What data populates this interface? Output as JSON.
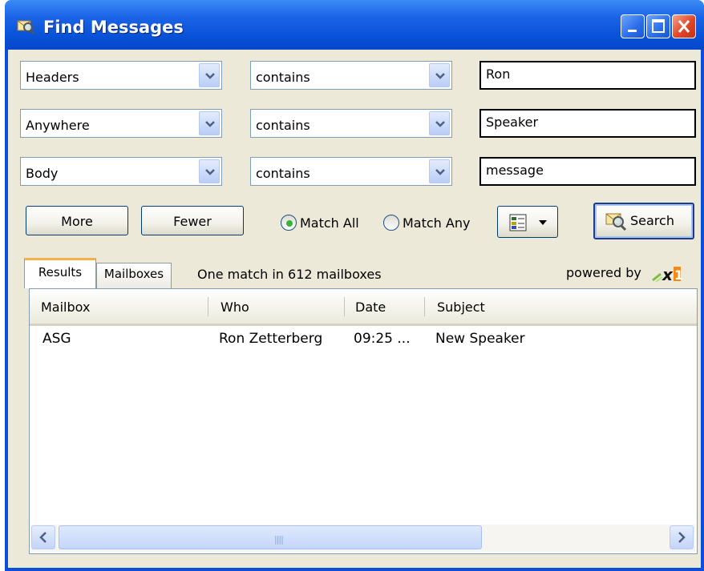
{
  "window": {
    "title": "Find Messages"
  },
  "criteria": [
    {
      "field": "Headers",
      "operator": "contains",
      "value": "Ron"
    },
    {
      "field": "Anywhere",
      "operator": "contains",
      "value": "Speaker"
    },
    {
      "field": "Body",
      "operator": "contains",
      "value": "message"
    }
  ],
  "buttons": {
    "more": "More",
    "fewer": "Fewer",
    "search": "Search"
  },
  "match": {
    "all_label": "Match All",
    "any_label": "Match Any",
    "selected": "all"
  },
  "tabs": {
    "results": "Results",
    "mailboxes": "Mailboxes",
    "active": "results"
  },
  "status_text": "One match in 612 mailboxes",
  "powered_by": "powered by",
  "table": {
    "columns": [
      "Mailbox",
      "Who",
      "Date",
      "Subject"
    ],
    "rows": [
      {
        "mailbox": "ASG",
        "who": "Ron Zetterberg",
        "date": "09:25 ...",
        "subject": "New Speaker"
      }
    ]
  },
  "colors": {
    "title_bar": "#0a4fd8",
    "client_bg": "#ece9d8",
    "radio_dot": "#3ab33a",
    "tab_highlight": "#f4b04a"
  },
  "icons": {
    "title": "find-messages-icon",
    "view": "column-view-icon",
    "search": "search-magnifier-icon",
    "logo": "x1-logo-icon"
  }
}
